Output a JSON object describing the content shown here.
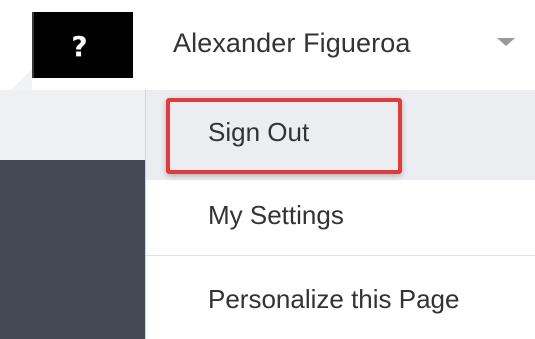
{
  "header": {
    "help_glyph": "?",
    "user_name": "Alexander Figueroa"
  },
  "user_menu": {
    "items": [
      {
        "label": "Sign Out"
      },
      {
        "label": "My Settings"
      },
      {
        "label": "Personalize this Page"
      }
    ],
    "highlighted_item": "Sign Out",
    "highlight_color": "#e23b3b"
  },
  "colors": {
    "help_bg": "#000000",
    "sidebar_dark": "#434a55",
    "menu_hover_bg": "#ebedf0",
    "text": "#333333"
  },
  "icons": {
    "help": "help-icon",
    "user_menu_toggle": "chevron-down-icon"
  }
}
